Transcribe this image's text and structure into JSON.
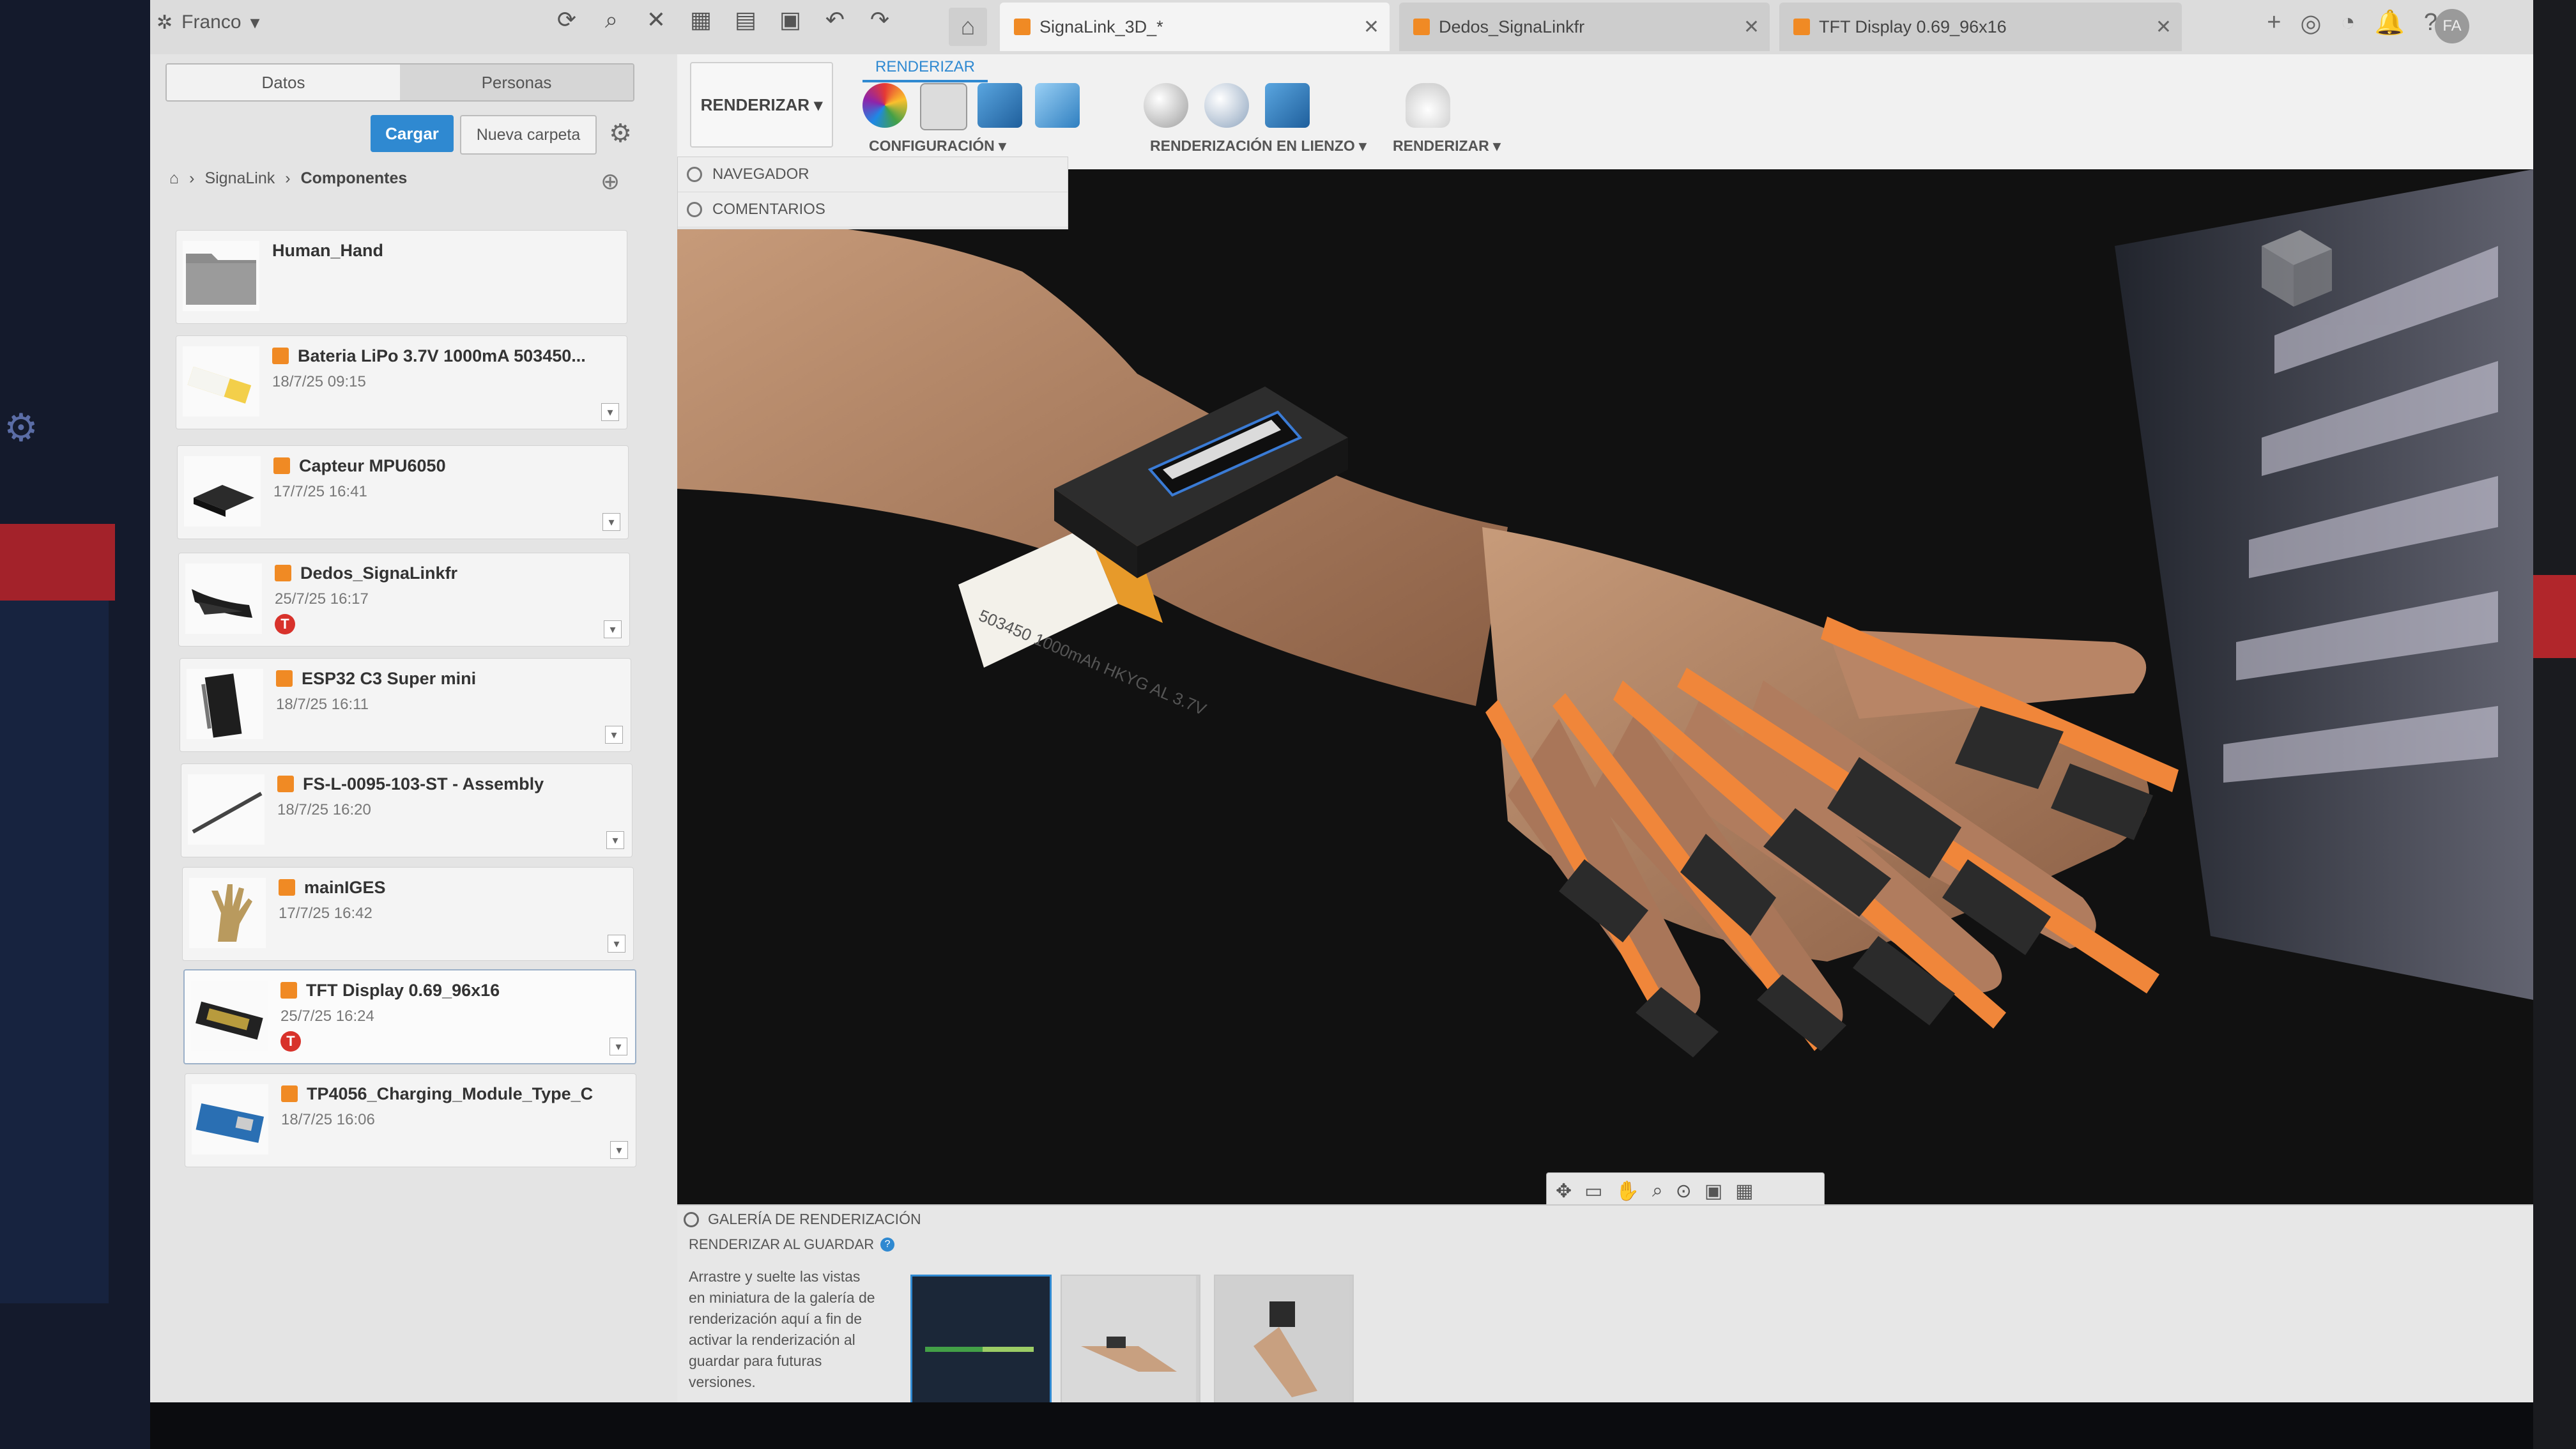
{
  "user": {
    "name": "Franco",
    "avatar": "FA"
  },
  "tabs": [
    {
      "label": "SignaLink_3D_*",
      "active": true
    },
    {
      "label": "Dedos_SignaLinkfr",
      "active": false
    },
    {
      "label": "TFT Display 0.69_96x16",
      "active": false
    }
  ],
  "panel": {
    "seg": [
      "Datos",
      "Personas"
    ],
    "upload_label": "Cargar",
    "new_folder_label": "Nueva carpeta",
    "breadcrumb": [
      "SignaLink",
      "Componentes"
    ],
    "items": [
      {
        "name": "Human_Hand",
        "date": "",
        "folder": true
      },
      {
        "name": "Bateria LiPo 3.7V 1000mA 503450...",
        "date": "18/7/25 09:15"
      },
      {
        "name": "Capteur MPU6050",
        "date": "17/7/25 16:41"
      },
      {
        "name": "Dedos_SignaLinkfr",
        "date": "25/7/25 16:17",
        "badge": "T"
      },
      {
        "name": "ESP32 C3 Super mini",
        "date": "18/7/25 16:11"
      },
      {
        "name": "FS-L-0095-103-ST - Assembly",
        "date": "18/7/25 16:20"
      },
      {
        "name": "mainIGES",
        "date": "17/7/25 16:42"
      },
      {
        "name": "TFT Display 0.69_96x16",
        "date": "25/7/25 16:24",
        "badge": "T",
        "selected": true
      },
      {
        "name": "TP4056_Charging_Module_Type_C",
        "date": "18/7/25 16:06"
      }
    ]
  },
  "ribbon": {
    "workspace": "RENDERIZAR ▾",
    "tab": "RENDERIZAR",
    "groups": [
      "CONFIGURACIÓN ▾",
      "RENDERIZACIÓN EN LIENZO ▾",
      "RENDERIZAR ▾"
    ]
  },
  "browser": {
    "rows": [
      "NAVEGADOR",
      "COMENTARIOS"
    ]
  },
  "model": {
    "battery_text": "503450 1000mAh HKYG AL 3.7V"
  },
  "gallery": {
    "title": "GALERÍA DE RENDERIZACIÓN",
    "subtitle": "RENDERIZAR AL GUARDAR",
    "description": "Arrastre y suelte las vistas en miniatura de la galería de renderización aquí a fin de activar la renderización al guardar para futuras versiones."
  },
  "colors": {
    "accent": "#2f89d1",
    "orange": "#f08a24",
    "badge": "#d8322b"
  }
}
